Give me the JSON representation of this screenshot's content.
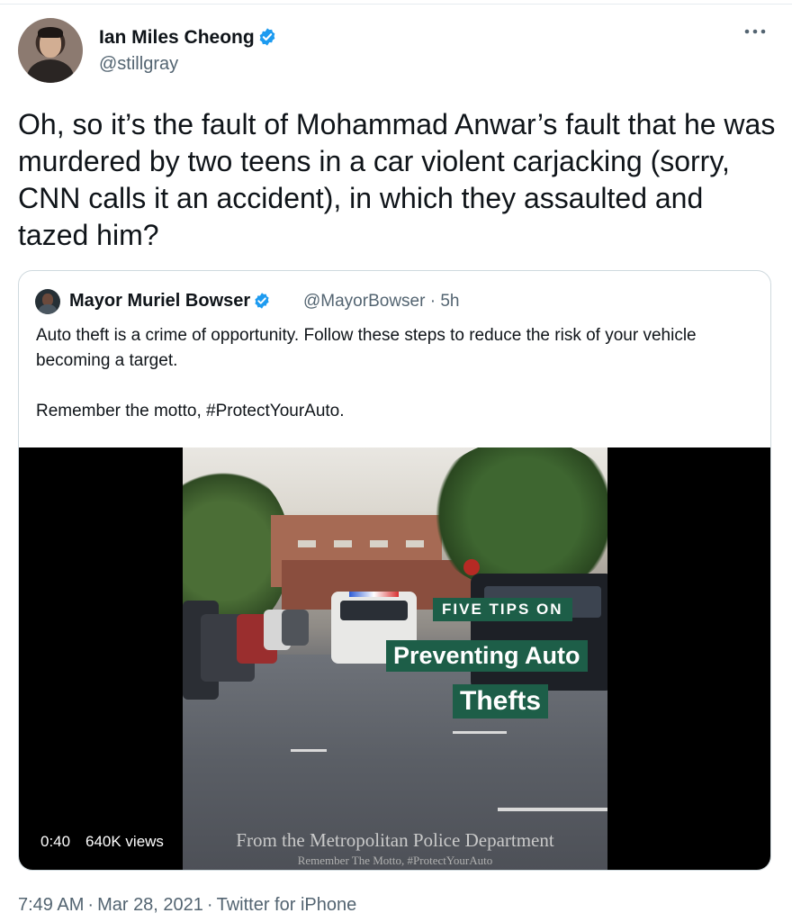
{
  "tweet": {
    "author_name": "Ian Miles Cheong",
    "handle": "@stillgray",
    "verified": true,
    "more_icon": "more-horizontal-icon",
    "text": "Oh, so it’s the fault of Mohammad Anwar’s fault that he was murdered by two teens in a car violent carjacking (sorry, CNN calls it an accident), in which they assaulted and tazed him?",
    "footer": {
      "time": "7:49 AM",
      "date": "Mar 28, 2021",
      "source": "Twitter for iPhone",
      "separator": "·"
    }
  },
  "quoted_tweet": {
    "author_name": "Mayor Muriel Bowser",
    "verified": true,
    "handle": "@MayorBowser",
    "separator": "·",
    "age": "5h",
    "text_paragraphs": [
      "Auto theft is a crime of opportunity. Follow these steps to reduce the risk of your vehicle becoming a target.",
      "Remember the motto, #ProtectYourAuto."
    ],
    "video": {
      "duration": "0:40",
      "views": "640K views",
      "overlay_line1": "FIVE TIPS ON",
      "overlay_line2": "Preventing Auto",
      "overlay_line3": "Thefts",
      "credit_line1": "From the Metropolitan Police Department",
      "credit_line2": "Remember The Motto, #ProtectYourAuto"
    }
  },
  "colors": {
    "verified_badge": "#1d9bf0",
    "secondary_text": "#536471",
    "border": "#cfd9de",
    "overlay_green": "#1d5e48"
  }
}
